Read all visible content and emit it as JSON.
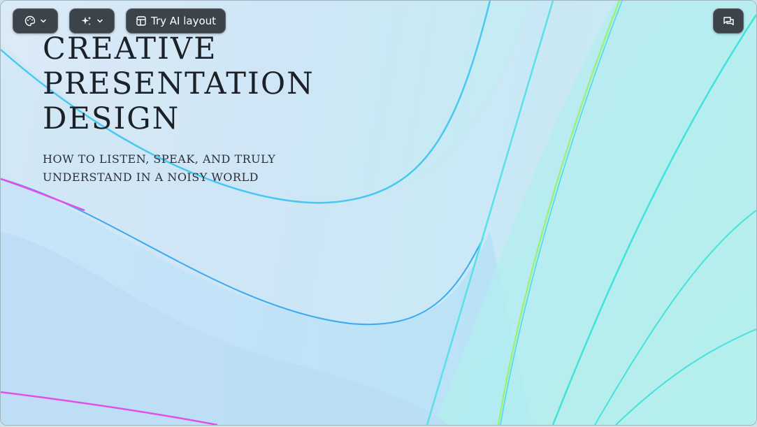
{
  "toolbar": {
    "theme_button": {
      "icon": "palette-icon",
      "dropdown_icon": "chevron-down-icon"
    },
    "ai_button": {
      "icon": "sparkle-icon",
      "dropdown_icon": "chevron-down-icon"
    },
    "layout_button": {
      "icon": "layout-icon",
      "label": "Try AI layout"
    },
    "comments_button": {
      "icon": "comment-icon"
    }
  },
  "slide": {
    "title_lines": [
      "CREATIVE",
      "PRESENTATION",
      "DESIGN"
    ],
    "subtitle": "HOW TO LISTEN, SPEAK, AND TRULY UNDERSTAND IN A NOISY WORLD"
  },
  "colors": {
    "toolbar_bg": "#3d434b",
    "title_text": "#1c2128",
    "wave_blue": "#5fc6f2",
    "wave_cyan": "#4fe6e0",
    "wave_pink": "#e24fe9"
  }
}
